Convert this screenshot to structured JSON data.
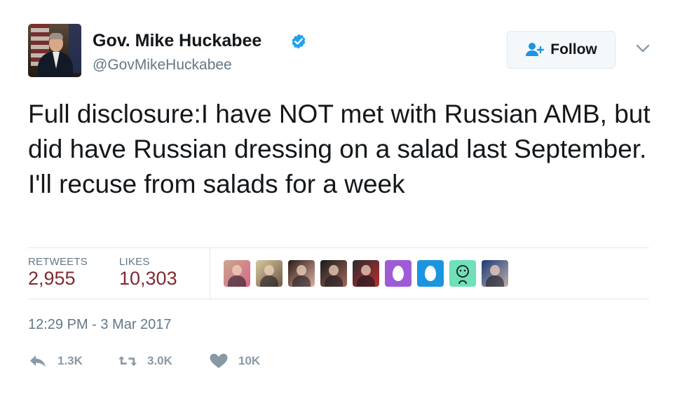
{
  "author": {
    "display_name": "Gov. Mike Huckabee",
    "handle": "@GovMikeHuckabee",
    "verified": true
  },
  "follow_button": {
    "label": "Follow"
  },
  "tweet": {
    "text": "Full disclosure:I have NOT met with Russian AMB, but did have Russian dressing on a salad last September. I'll recuse from salads for a week"
  },
  "stats": {
    "retweets_label": "RETWEETS",
    "retweets_value": "2,955",
    "likes_label": "LIKES",
    "likes_value": "10,303"
  },
  "likers": [
    {
      "name": "liker-avatar-1",
      "kind": "photo",
      "colors": [
        "#c9a78d",
        "#d9668a"
      ]
    },
    {
      "name": "liker-avatar-2",
      "kind": "photo",
      "colors": [
        "#d8c8a0",
        "#6d5a44"
      ]
    },
    {
      "name": "liker-avatar-3",
      "kind": "photo",
      "colors": [
        "#2a1a18",
        "#e0b0a0"
      ]
    },
    {
      "name": "liker-avatar-4",
      "kind": "photo",
      "colors": [
        "#1a1a1a",
        "#a06858"
      ]
    },
    {
      "name": "liker-avatar-5",
      "kind": "photo",
      "colors": [
        "#2a2a30",
        "#b83030"
      ]
    },
    {
      "name": "liker-avatar-6",
      "kind": "egg",
      "colors": [
        "#9e5bd6",
        "#ffffff"
      ]
    },
    {
      "name": "liker-avatar-7",
      "kind": "egg",
      "colors": [
        "#1b95e0",
        "#ffffff"
      ]
    },
    {
      "name": "liker-avatar-8",
      "kind": "cartoon",
      "colors": [
        "#6fe0b8",
        "#1a1a1a"
      ]
    },
    {
      "name": "liker-avatar-9",
      "kind": "photo",
      "colors": [
        "#1b3a78",
        "#c0b0a8"
      ]
    }
  ],
  "timestamp": "12:29 PM - 3 Mar 2017",
  "actions": {
    "reply_count": "1.3K",
    "retweet_count": "3.0K",
    "like_count": "10K"
  },
  "colors": {
    "verified_badge": "#1da1f2",
    "stat_value": "#802a31",
    "muted_text": "#657786",
    "follow_icon": "#1b95e0"
  },
  "icons": {
    "verified": "verified-badge-icon",
    "follow": "follow-person-plus-icon",
    "caret": "chevron-down-icon",
    "reply": "reply-icon",
    "retweet": "retweet-icon",
    "like": "heart-icon"
  }
}
